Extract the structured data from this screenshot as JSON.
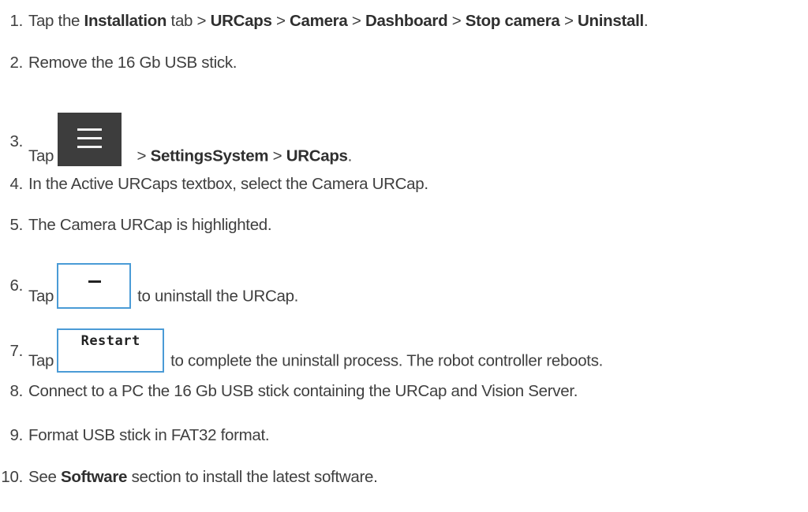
{
  "steps": [
    {
      "num": "1.",
      "parts": [
        {
          "t": "Tap the "
        },
        {
          "b": "Installation"
        },
        {
          "t": " tab > "
        },
        {
          "b": "URCaps"
        },
        {
          "t": " > "
        },
        {
          "b": "Camera"
        },
        {
          "t": " > "
        },
        {
          "b": "Dashboard"
        },
        {
          "t": " > "
        },
        {
          "b": "Stop camera"
        },
        {
          "t": " > "
        },
        {
          "b": "Uninstall"
        },
        {
          "t": "."
        }
      ]
    },
    {
      "num": "2.",
      "text": "Remove the 16 Gb USB stick."
    },
    {
      "num": "3.",
      "pre": "Tap",
      "button_icon": "hamburger-menu-icon",
      "post_parts": [
        {
          "t": " > "
        },
        {
          "b": "SettingsSystem"
        },
        {
          "t": " > "
        },
        {
          "b": "URCaps"
        },
        {
          "t": "."
        }
      ]
    },
    {
      "num": "4.",
      "text": "In the Active URCaps textbox, select the Camera URCap."
    },
    {
      "num": "5.",
      "text": "The Camera URCap is highlighted."
    },
    {
      "num": "6.",
      "pre": "Tap",
      "button_icon": "minus-icon",
      "post": "to uninstall the URCap."
    },
    {
      "num": "7.",
      "pre": "Tap",
      "button_label": "Restart",
      "post": "to complete the uninstall process. The robot controller reboots."
    },
    {
      "num": "8.",
      "text": "Connect to a PC the 16 Gb USB stick containing the URCap and Vision Server."
    },
    {
      "num": "9.",
      "text": "Format USB stick in FAT32 format."
    },
    {
      "num": "10.",
      "parts": [
        {
          "t": "See "
        },
        {
          "b": "Software"
        },
        {
          "t": " section to install the latest software."
        }
      ]
    }
  ]
}
